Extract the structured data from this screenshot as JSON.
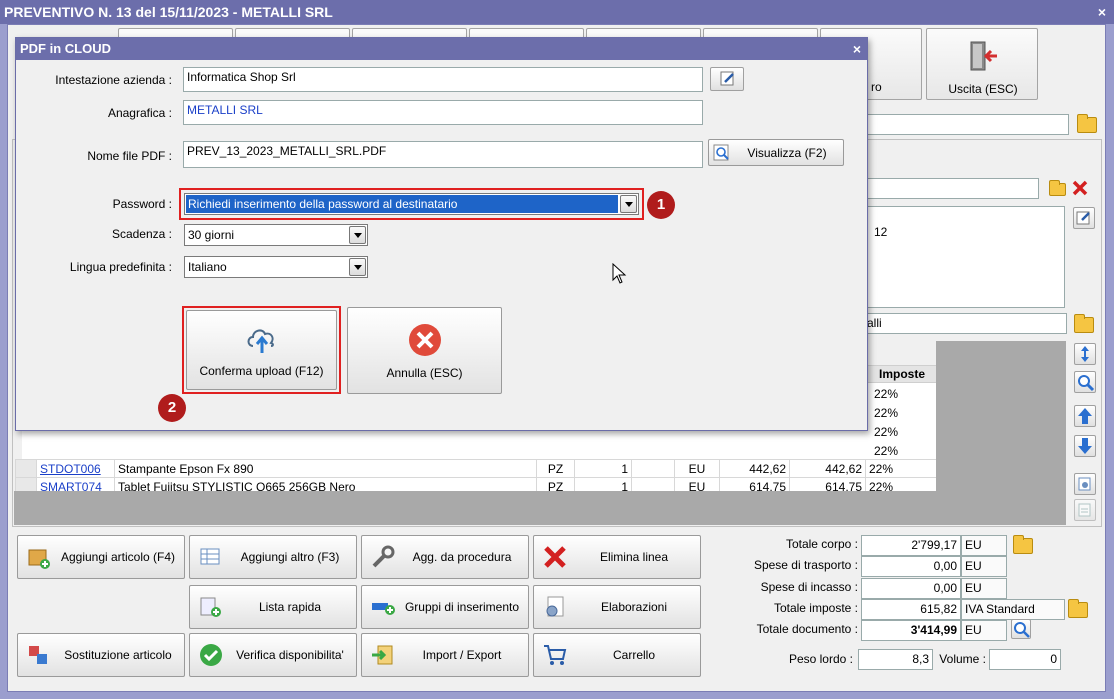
{
  "window": {
    "title": "PREVENTIVO N. 13 del 15/11/2023 - METALLI SRL",
    "close": "×"
  },
  "toolbar": {
    "partial_label": "ro",
    "exit_label": "Uscita (ESC)"
  },
  "right_panel": {
    "notes_value": "12",
    "ref_value": "alli"
  },
  "grid": {
    "header_imposte": "Imposte",
    "hidden_imposte": [
      "22%",
      "22%",
      "22%",
      "22%"
    ],
    "rows": [
      {
        "code": "STDOT006",
        "desc": "Stampante Epson Fx 890",
        "um": "PZ",
        "qty": "1",
        "cur": "EU",
        "price": "442,62",
        "total": "442,62",
        "tax": "22%"
      },
      {
        "code": "SMART074",
        "desc": "Tablet Fujitsu STYLISTIC Q665 256GB Nero",
        "um": "PZ",
        "qty": "1",
        "cur": "EU",
        "price": "614,75",
        "total": "614,75",
        "tax": "22%"
      }
    ]
  },
  "actions": {
    "add_article": "Aggiungi articolo (F4)",
    "add_other": "Aggiungi altro (F3)",
    "add_procedure": "Agg. da procedura",
    "delete_line": "Elimina linea",
    "quick_list": "Lista rapida",
    "insert_groups": "Gruppi di inserimento",
    "processing": "Elaborazioni",
    "replace_article": "Sostituzione articolo",
    "check_availability": "Verifica disponibilita'",
    "import_export": "Import / Export",
    "cart": "Carrello"
  },
  "totals": {
    "body_label": "Totale corpo :",
    "body_value": "2'799,17",
    "body_cur": "EU",
    "transport_label": "Spese di trasporto :",
    "transport_value": "0,00",
    "transport_cur": "EU",
    "collection_label": "Spese di incasso :",
    "collection_value": "0,00",
    "collection_cur": "EU",
    "tax_label": "Totale imposte :",
    "tax_value": "615,82",
    "tax_type": "IVA Standard",
    "doc_label": "Totale documento :",
    "doc_value": "3'414,99",
    "doc_cur": "EU",
    "weight_label": "Peso lordo :",
    "weight_value": "8,3",
    "volume_label": "Volume :",
    "volume_value": "0"
  },
  "dialog": {
    "title": "PDF in CLOUD",
    "close": "×",
    "company_label": "Intestazione azienda :",
    "company_value": "Informatica Shop Srl",
    "registry_label": "Anagrafica :",
    "registry_value": "METALLI SRL",
    "filename_label": "Nome file PDF :",
    "filename_value": "PREV_13_2023_METALLI_SRL.PDF",
    "view_button": "Visualizza (F2)",
    "password_label": "Password :",
    "password_value": "Richiedi inserimento della password al destinatario",
    "expiry_label": "Scadenza :",
    "expiry_value": "30 giorni",
    "language_label": "Lingua predefinita :",
    "language_value": "Italiano",
    "confirm_button": "Conferma upload (F12)",
    "cancel_button": "Annulla (ESC)"
  },
  "badges": {
    "one": "1",
    "two": "2"
  },
  "colors": {
    "title_bar": "#6c6eab",
    "highlight": "#e02020",
    "badge": "#b01c1c",
    "selection": "#1e64c8"
  }
}
